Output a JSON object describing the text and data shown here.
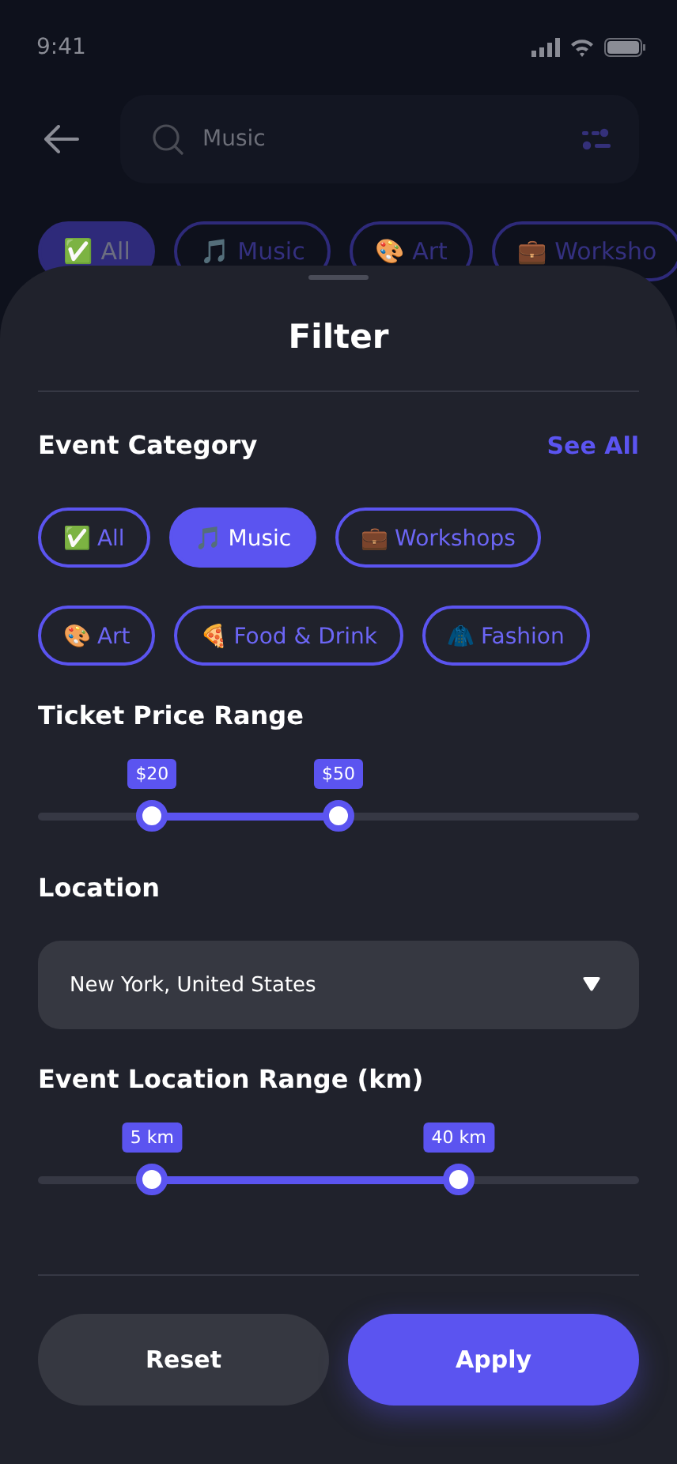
{
  "status_bar": {
    "time": "9:41"
  },
  "search": {
    "value": "Music"
  },
  "background_chips": [
    {
      "label": "✅ All",
      "selected": true
    },
    {
      "label": "🎵 Music",
      "selected": false
    },
    {
      "label": "🎨 Art",
      "selected": false
    },
    {
      "label": "💼 Worksho",
      "selected": false
    }
  ],
  "sheet": {
    "title": "Filter",
    "category": {
      "heading": "Event Category",
      "link": "See All",
      "chips": [
        {
          "label": "✅ All",
          "selected": false
        },
        {
          "label": "🎵 Music",
          "selected": true
        },
        {
          "label": "💼 Workshops",
          "selected": false
        },
        {
          "label": "🎨 Art",
          "selected": false
        },
        {
          "label": "🍕 Food & Drink",
          "selected": false
        },
        {
          "label": "🧥 Fashion",
          "selected": false
        }
      ]
    },
    "price": {
      "heading": "Ticket Price Range",
      "thumbs": [
        {
          "label": "$20",
          "level": 0.19
        },
        {
          "label": "$50",
          "level": 0.5
        }
      ]
    },
    "location": {
      "heading": "Location",
      "value": "New York, United States"
    },
    "distance": {
      "heading": "Event Location Range (km)",
      "thumbs": [
        {
          "label": "5 km",
          "level": 0.19
        },
        {
          "label": "40 km",
          "level": 0.7
        }
      ]
    },
    "buttons": [
      {
        "label": "Reset",
        "kind": "secondary"
      },
      {
        "label": "Apply",
        "kind": "primary"
      }
    ]
  }
}
